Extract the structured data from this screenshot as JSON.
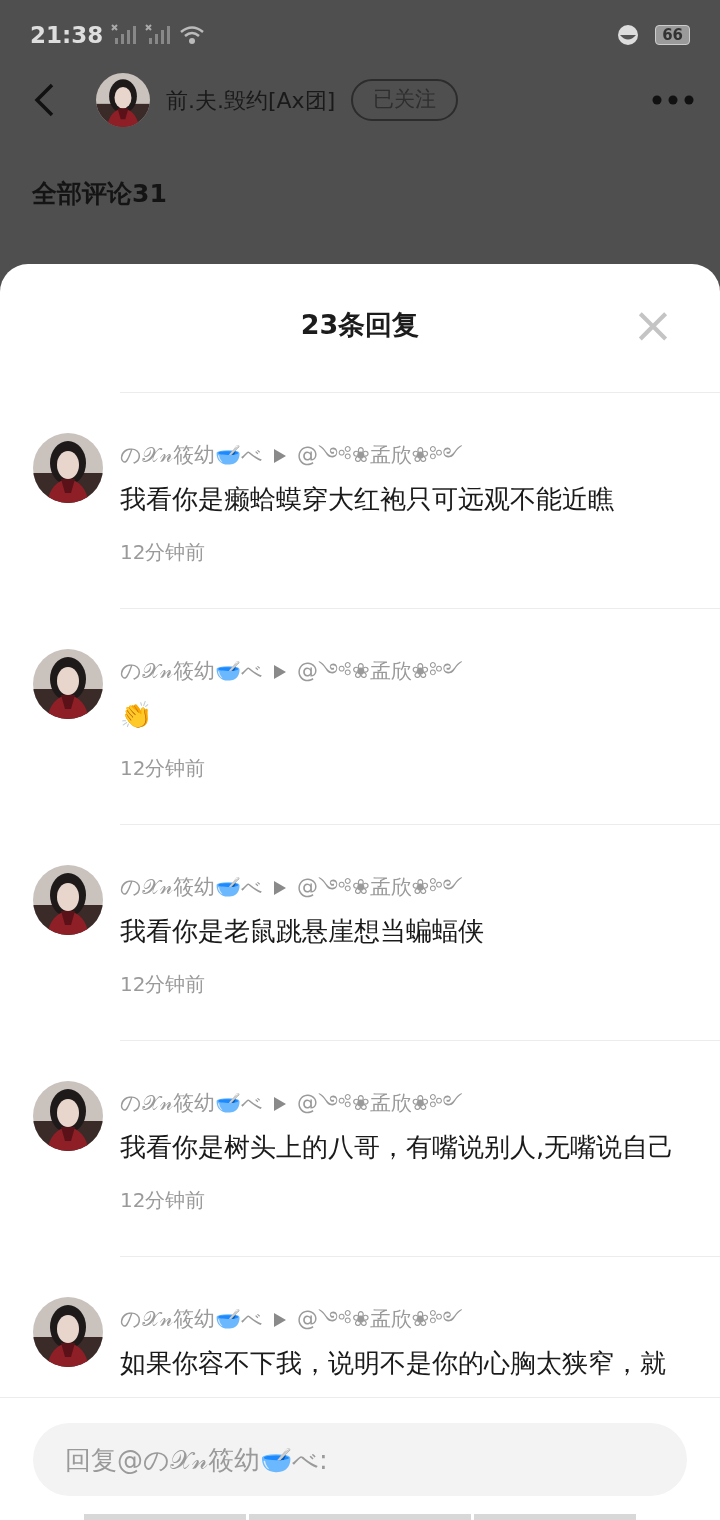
{
  "status_bar": {
    "time": "21:38",
    "battery": "66"
  },
  "header": {
    "username": "前.夫.毁约[Ax团]",
    "follow_button": "已关注"
  },
  "section_title": "全部评论31",
  "sheet": {
    "title": "23条回复",
    "close": "×"
  },
  "replies": [
    {
      "author": "の𝒳𝓃筱幼🥣べ",
      "target": "@༺❀孟欣❀༻",
      "text": "我看你是癞蛤蟆穿大红袍只可远观不能近瞧",
      "time": "12分钟前"
    },
    {
      "author": "の𝒳𝓃筱幼🥣べ",
      "target": "@༺❀孟欣❀༻",
      "text": "👏",
      "time": "12分钟前"
    },
    {
      "author": "の𝒳𝓃筱幼🥣べ",
      "target": "@༺❀孟欣❀༻",
      "text": "我看你是老鼠跳悬崖想当蝙蝠侠",
      "time": "12分钟前"
    },
    {
      "author": "の𝒳𝓃筱幼🥣べ",
      "target": "@༺❀孟欣❀༻",
      "text": "我看你是树头上的八哥，有嘴说别人,无嘴说自己",
      "time": "12分钟前"
    },
    {
      "author": "の𝒳𝓃筱幼🥣べ",
      "target": "@༺❀孟欣❀༻",
      "text": "如果你容不下我，说明不是你的心胸太狭窄，就"
    }
  ],
  "reply_input": {
    "placeholder": "回复@の𝒳𝓃筱幼🥣べ:"
  }
}
